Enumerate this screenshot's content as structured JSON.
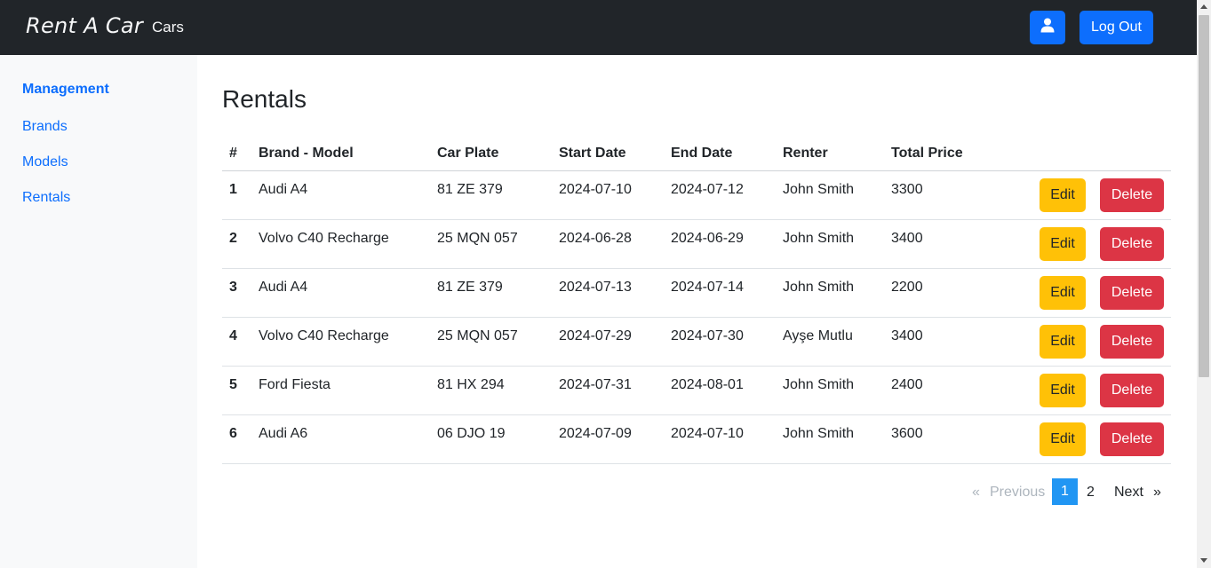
{
  "navbar": {
    "brand": "Rent A Car",
    "cars_link": "Cars",
    "user_icon": "user-icon",
    "logout_label": "Log Out"
  },
  "sidebar": {
    "items": [
      {
        "label": "Management",
        "active": true
      },
      {
        "label": "Brands"
      },
      {
        "label": "Models"
      },
      {
        "label": "Rentals"
      }
    ]
  },
  "main": {
    "title": "Rentals",
    "columns": [
      "#",
      "Brand - Model",
      "Car Plate",
      "Start Date",
      "End Date",
      "Renter",
      "Total Price"
    ],
    "rows": [
      {
        "num": "1",
        "model": "Audi A4",
        "plate": "81 ZE 379",
        "start": "2024-07-10",
        "end": "2024-07-12",
        "renter": "John Smith",
        "price": "3300"
      },
      {
        "num": "2",
        "model": "Volvo C40 Recharge",
        "plate": "25 MQN 057",
        "start": "2024-06-28",
        "end": "2024-06-29",
        "renter": "John Smith",
        "price": "3400"
      },
      {
        "num": "3",
        "model": "Audi A4",
        "plate": "81 ZE 379",
        "start": "2024-07-13",
        "end": "2024-07-14",
        "renter": "John Smith",
        "price": "2200"
      },
      {
        "num": "4",
        "model": "Volvo C40 Recharge",
        "plate": "25 MQN 057",
        "start": "2024-07-29",
        "end": "2024-07-30",
        "renter": "Ayşe Mutlu",
        "price": "3400"
      },
      {
        "num": "5",
        "model": "Ford Fiesta",
        "plate": "81 HX 294",
        "start": "2024-07-31",
        "end": "2024-08-01",
        "renter": "John Smith",
        "price": "2400"
      },
      {
        "num": "6",
        "model": "Audi A6",
        "plate": "06 DJO 19",
        "start": "2024-07-09",
        "end": "2024-07-10",
        "renter": "John Smith",
        "price": "3600"
      }
    ],
    "edit_label": "Edit",
    "delete_label": "Delete"
  },
  "pagination": {
    "first": "«",
    "previous": "Previous",
    "pages": [
      "1",
      "2"
    ],
    "current": "1",
    "next": "Next",
    "last": "»"
  },
  "colors": {
    "navbar_bg": "#212529",
    "primary": "#0d6efd",
    "warning": "#ffc107",
    "danger": "#dc3545",
    "page_active": "#2196f3"
  }
}
